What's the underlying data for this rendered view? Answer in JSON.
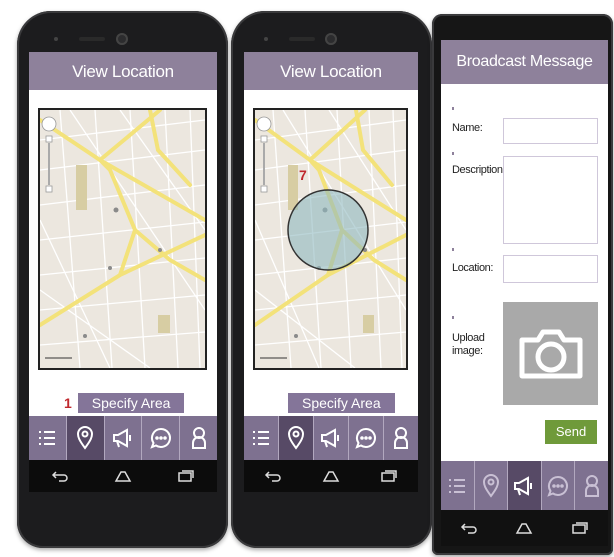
{
  "screens": [
    {
      "header_title": "View Location",
      "step_number": "1",
      "specify_label": "Specify Area"
    },
    {
      "header_title": "View Location",
      "step_number": "7",
      "specify_label": "Specify Area"
    },
    {
      "header_title": "Broadcast Message",
      "form": {
        "name_label": "Name:",
        "description_label": "Description",
        "location_label": "Location:",
        "upload_label": "Upload image:",
        "send_label": "Send"
      }
    }
  ],
  "tabs": [
    {
      "icon": "list-icon"
    },
    {
      "icon": "location-pin-icon"
    },
    {
      "icon": "megaphone-icon"
    },
    {
      "icon": "chat-bubble-icon"
    },
    {
      "icon": "person-icon"
    }
  ],
  "nav": [
    {
      "icon": "back-icon"
    },
    {
      "icon": "home-icon"
    },
    {
      "icon": "recent-apps-icon"
    }
  ],
  "colors": {
    "header": "#8e819b",
    "tab_bar": "#7e7190",
    "tab_active": "#574a66",
    "specify_button": "#847599",
    "send_button": "#6f9a3a",
    "step_number": "#c0282d",
    "area_circle": "#8fb9c0"
  }
}
